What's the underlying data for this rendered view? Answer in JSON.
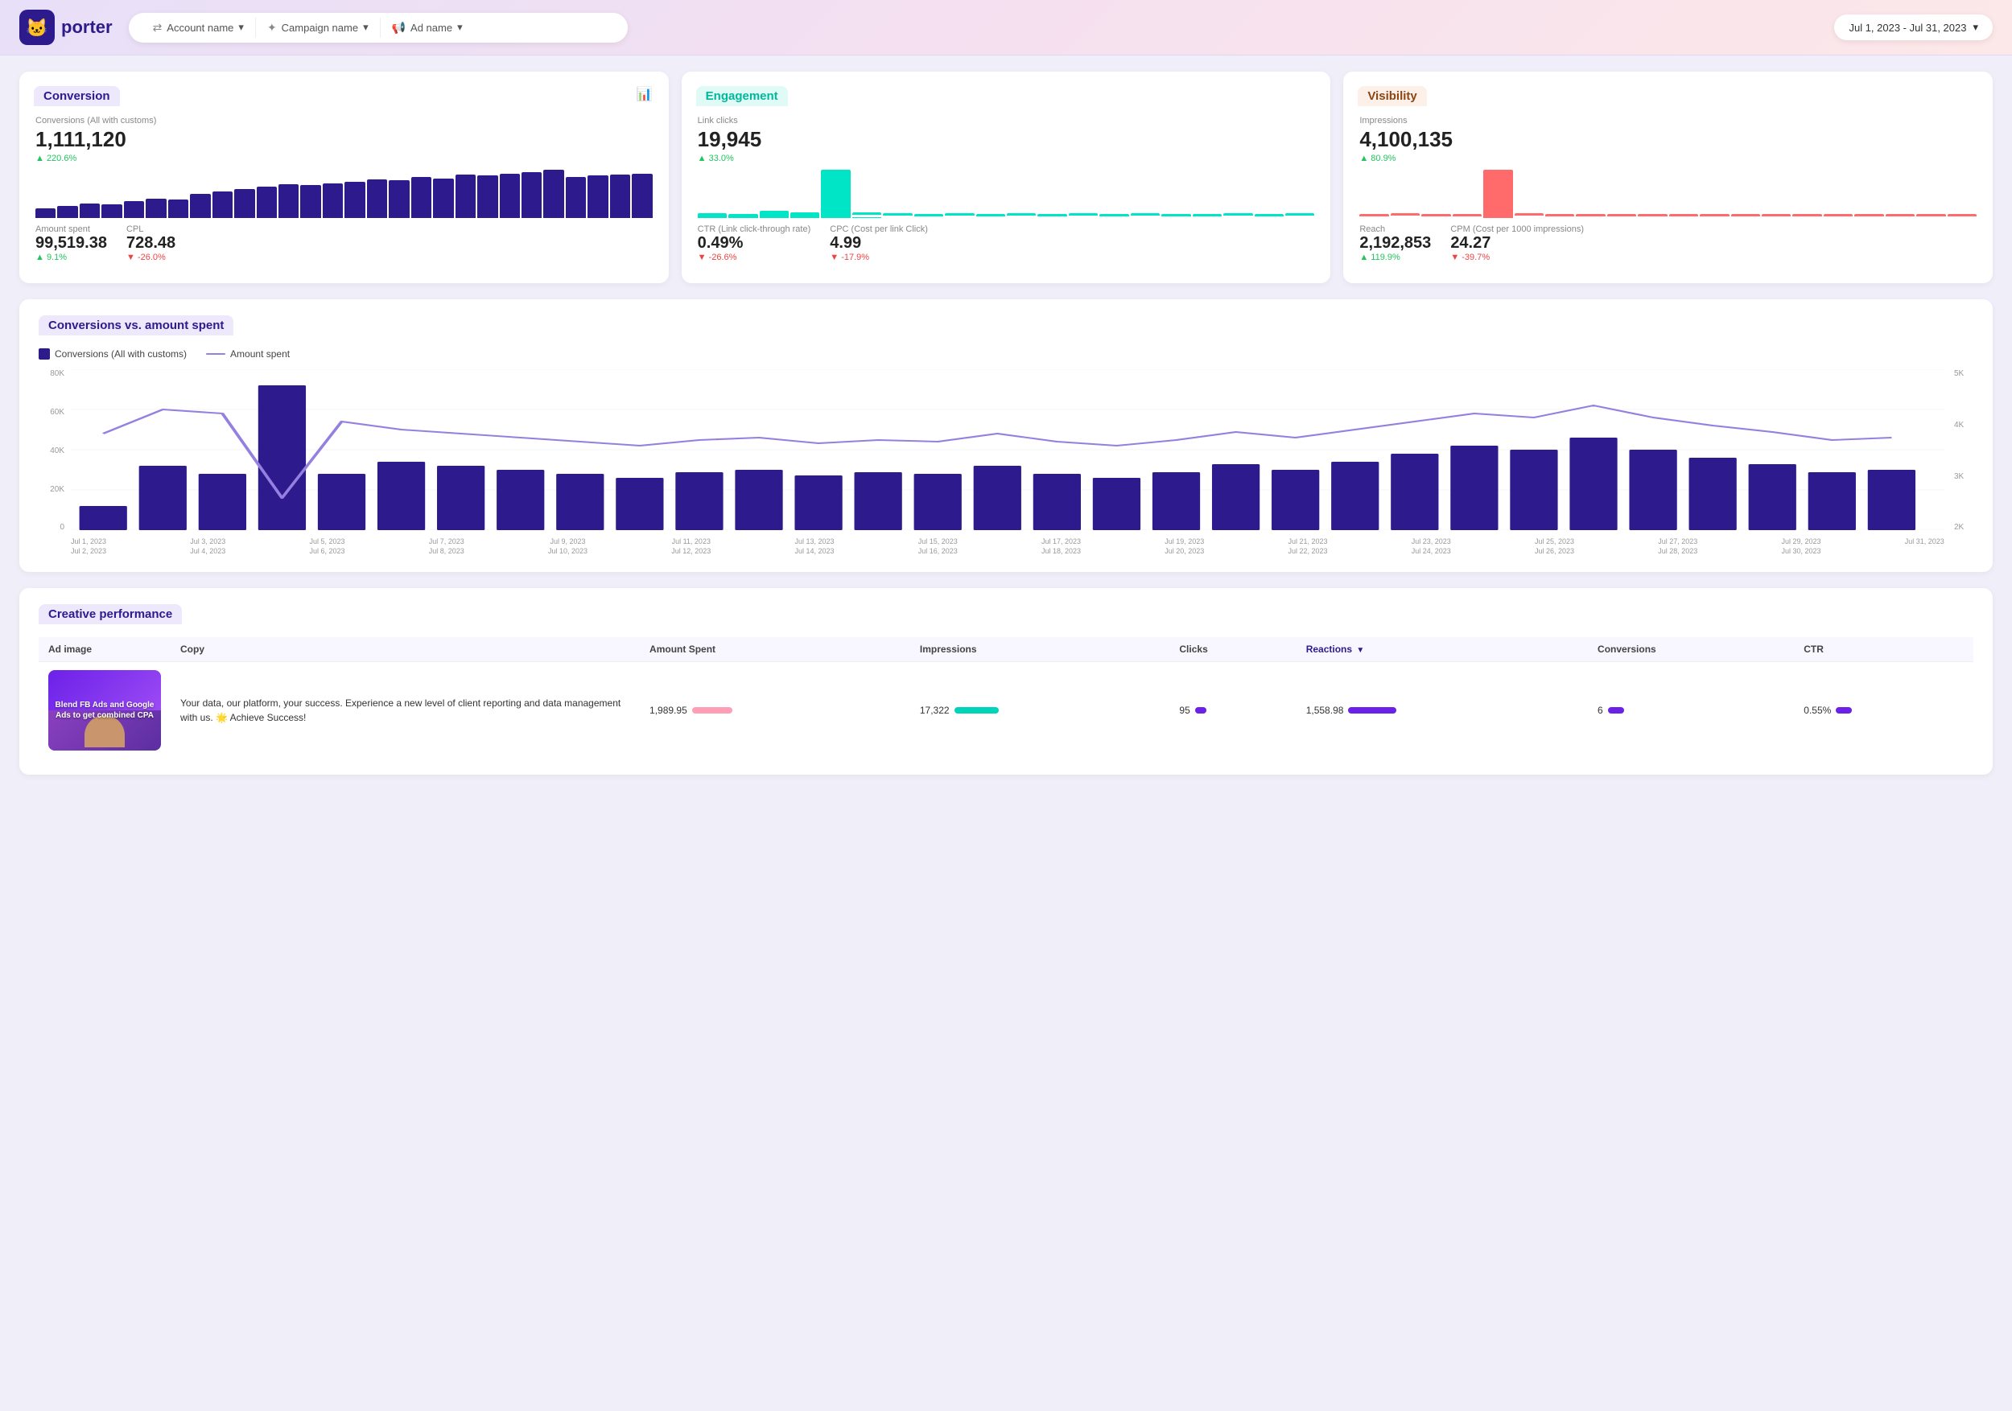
{
  "header": {
    "logo_text": "porter",
    "account_label": "Account name",
    "campaign_label": "Campaign name",
    "ad_label": "Ad name",
    "date_range": "Jul 1, 2023 - Jul 31, 2023"
  },
  "conversion_card": {
    "title": "Conversion",
    "main_metric_label": "Conversions (All with customs)",
    "main_metric_value": "1,111,120",
    "main_metric_change": "▲ 220.6%",
    "main_metric_change_dir": "up",
    "sub1_label": "Amount spent",
    "sub1_value": "99,519.38",
    "sub1_change": "▲ 9.1%",
    "sub1_change_dir": "up",
    "sub2_label": "CPL",
    "sub2_value": "728.48",
    "sub2_change": "▼ -26.0%",
    "sub2_change_dir": "down"
  },
  "engagement_card": {
    "title": "Engagement",
    "main_metric_label": "Link clicks",
    "main_metric_value": "19,945",
    "main_metric_change": "▲ 33.0%",
    "main_metric_change_dir": "up",
    "sub1_label": "CTR (Link click-through rate)",
    "sub1_value": "0.49%",
    "sub1_change": "▼ -26.6%",
    "sub1_change_dir": "down",
    "sub2_label": "CPC (Cost per link Click)",
    "sub2_value": "4.99",
    "sub2_change": "▼ -17.9%",
    "sub2_change_dir": "down"
  },
  "visibility_card": {
    "title": "Visibility",
    "main_metric_label": "Impressions",
    "main_metric_value": "4,100,135",
    "main_metric_change": "▲ 80.9%",
    "main_metric_change_dir": "up",
    "sub1_label": "Reach",
    "sub1_value": "2,192,853",
    "sub1_change": "▲ 119.9%",
    "sub1_change_dir": "up",
    "sub2_label": "CPM (Cost per 1000 impressions)",
    "sub2_value": "24.27",
    "sub2_change": "▼ -39.7%",
    "sub2_change_dir": "down"
  },
  "main_chart": {
    "title": "Conversions vs. amount spent",
    "legend_bar": "Conversions (All with customs)",
    "legend_line": "Amount spent",
    "y_left_labels": [
      "80K",
      "60K",
      "40K",
      "20K",
      "0"
    ],
    "y_right_labels": [
      "5K",
      "4K",
      "3K",
      "2K"
    ],
    "x_labels": [
      {
        "top": "Jul 1, 2023",
        "bot": "Jul 2, 2023"
      },
      {
        "top": "Jul 3, 2023",
        "bot": "Jul 4, 2023"
      },
      {
        "top": "Jul 5, 2023",
        "bot": "Jul 6, 2023"
      },
      {
        "top": "Jul 7, 2023",
        "bot": "Jul 8, 2023"
      },
      {
        "top": "Jul 9, 2023",
        "bot": "Jul 10, 2023"
      },
      {
        "top": "Jul 11, 2023",
        "bot": "Jul 12, 2023"
      },
      {
        "top": "Jul 13, 2023",
        "bot": "Jul 14, 2023"
      },
      {
        "top": "Jul 15, 2023",
        "bot": "Jul 16, 2023"
      },
      {
        "top": "Jul 17, 2023",
        "bot": "Jul 18, 2023"
      },
      {
        "top": "Jul 19, 2023",
        "bot": "Jul 20, 2023"
      },
      {
        "top": "Jul 21, 2023",
        "bot": "Jul 22, 2023"
      },
      {
        "top": "Jul 23, 2023",
        "bot": "Jul 24, 2023"
      },
      {
        "top": "Jul 25, 2023",
        "bot": "Jul 26, 2023"
      },
      {
        "top": "Jul 27, 2023",
        "bot": "Jul 28, 2023"
      },
      {
        "top": "Jul 29, 2023",
        "bot": "Jul 30, 2023"
      },
      {
        "top": "Jul 31, 2023",
        "bot": ""
      }
    ]
  },
  "creative_table": {
    "title": "Creative performance",
    "columns": [
      "Ad image",
      "Copy",
      "Amount Spent",
      "Impressions",
      "Clicks",
      "Reactions",
      "Conversions",
      "CTR"
    ],
    "rows": [
      {
        "ad_text": "Blend FB Ads and Google Ads to get combined CPA",
        "copy": "Your data, our platform, your success. Experience a new level of client reporting and data management with us. 🌟 Achieve Success!",
        "amount_spent": "1,989.95",
        "amount_bar": 40,
        "impressions": "17,322",
        "impressions_bar": 45,
        "clicks": "95",
        "clicks_bar": 15,
        "reactions": "1,558.98",
        "reactions_bar": 70,
        "conversions": "6",
        "conversions_bar": 20,
        "ctr": "0.55%",
        "ctr_bar": 20
      }
    ]
  }
}
